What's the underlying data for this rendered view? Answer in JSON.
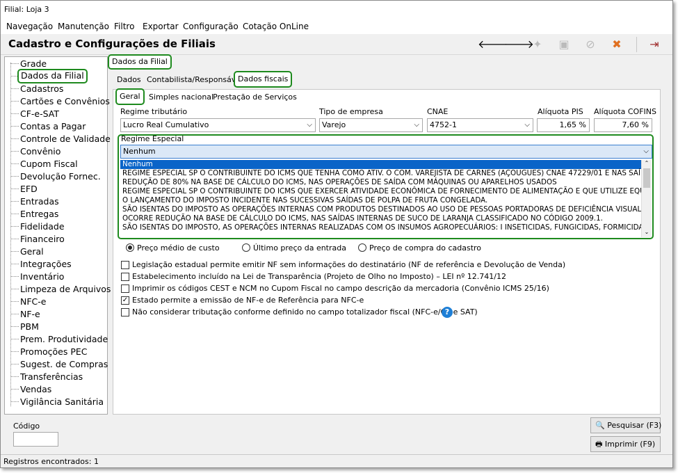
{
  "window": {
    "title": "Filial: Loja 3"
  },
  "menu": [
    "Navegação",
    "Manutenção",
    "Filtro",
    "Exportar",
    "Configuração",
    "Cotação OnLine"
  ],
  "header": {
    "title": "Cadastro e Configurações de Filiais"
  },
  "toolbar": {
    "back": "back-arrow-icon",
    "forward": "forward-arrow-icon",
    "new": "new-doc-icon",
    "save": "save-icon",
    "cancel": "cancel-icon",
    "delete": "delete-icon",
    "exit": "exit-icon",
    "back_glyph": "🡐",
    "forward_glyph": "🡒",
    "new_glyph": "✦",
    "save_glyph": "▣",
    "cancel_glyph": "⊘",
    "delete_glyph": "✖",
    "exit_glyph": "⇥"
  },
  "tree": [
    "Grade",
    "Dados da Filial",
    "Cadastros",
    "Cartões e Convênios",
    "CF-e-SAT",
    "Contas a Pagar",
    "Controle de Validade",
    "Convênio",
    "Cupom Fiscal",
    "Devolução Fornec.",
    "EFD",
    "Entradas",
    "Entregas",
    "Fidelidade",
    "Financeiro",
    "Geral",
    "Integrações",
    "Inventário",
    "Limpeza de Arquivos",
    "NFC-e",
    "NF-e",
    "PBM",
    "Prem. Produtividade",
    "Promoções PEC",
    "Sugest. de Compras",
    "Transferências",
    "Vendas",
    "Vigilância Sanitária"
  ],
  "tabs": {
    "top": "Dados da Filial",
    "second": [
      "Dados",
      "Contabilista/Responsável",
      "Dados fiscais"
    ],
    "third": [
      "Geral",
      "Simples nacional",
      "Prestação de Serviços"
    ]
  },
  "fields": {
    "regime_tributario": {
      "label": "Regime tributário",
      "value": "Lucro Real Cumulativo"
    },
    "tipo_empresa": {
      "label": "Tipo de empresa",
      "value": "Varejo"
    },
    "cnae": {
      "label": "CNAE",
      "value": "4752-1"
    },
    "aliquota_pis": {
      "label": "Alíquota PIS",
      "value": "1,65 %"
    },
    "aliquota_cofins": {
      "label": "Alíquota COFINS",
      "value": "7,60 %"
    },
    "regime_especial": {
      "label": "Regime Especial",
      "value": "Nenhum"
    }
  },
  "regime_options": [
    "Nenhum",
    "REGIME ESPECIAL SP  O CONTRIBUINTE DO ICMS QUE TENHA COMO ATIV. O COM. VAREJISTA DE CARNES (AÇOUGUES)  CNAE 47229/01 E NAS SAÍDA",
    "REDUÇÃO DE 80% NA BASE DE CÁLCULO DO ICMS, NAS OPERAÇÕES DE SAÍDA COM MÁQUINAS OU APARELHOS USADOS",
    "REGIME ESPECIAL SP  O CONTRIBUINTE DO ICMS QUE EXERCER ATIVIDADE ECONÔMICA DE FORNECIMENTO DE ALIMENTAÇÃO E QUE UTILIZE EQUIPAME",
    "O LANÇAMENTO DO IMPOSTO INCIDENTE NAS SUCESSIVAS SAÍDAS DE POLPA DE FRUTA CONGELADA.",
    "SÃO ISENTAS DO IMPOSTO AS OPERAÇÕES INTERNAS COM PRODUTOS DESTINADOS AO USO DE PESSOAS PORTADORAS DE DEFICIÊNCIA VISUAL, R",
    "OCORRE REDUÇÃO NA BASE DE CÁLCULO DO ICMS, NAS SAÍDAS INTERNAS DE SUCO DE LARANJA CLASSIFICADO NO CÓDIGO 2009.1.",
    "SÃO ISENTAS DO IMPOSTO, AS OPERAÇÕES INTERNAS REALIZADAS COM OS INSUMOS AGROPECUÁRIOS: I  INSETICIDAS, FUNGICIDAS, FORMICIDAS,"
  ],
  "radios": [
    "Preço médio de custo",
    "Último preço da entrada",
    "Preço de compra do cadastro"
  ],
  "checks": [
    {
      "label": "Legislação estadual permite emitir NF sem informações do destinatário (NF de referência e Devolução de Venda)",
      "checked": false
    },
    {
      "label": "Estabelecimento incluído na Lei de Transparência (Projeto de Olho no Imposto) – LEI nº 12.741/12",
      "checked": false
    },
    {
      "label": "Imprimir os códigos CEST e NCM no Cupom Fiscal no campo descrição da mercadoria (Convênio ICMS 25/16)",
      "checked": false
    },
    {
      "label": "Estado permite a emissão de NF-e de Referência para NFC-e",
      "checked": true
    },
    {
      "label": "Não considerar tributação conforme definido no campo totalizador fiscal (NFC-e/CF-e SAT)",
      "checked": false
    }
  ],
  "footer": {
    "codigo_label": "Código",
    "codigo_value": "",
    "search_label": "Pesquisar (F3)",
    "print_label": "Imprimir (F9)"
  },
  "status": "Registros encontrados: 1",
  "colors": {
    "highlight": "#1e8a1e",
    "selection": "#0a64c8",
    "help": "#1e7fd6"
  }
}
